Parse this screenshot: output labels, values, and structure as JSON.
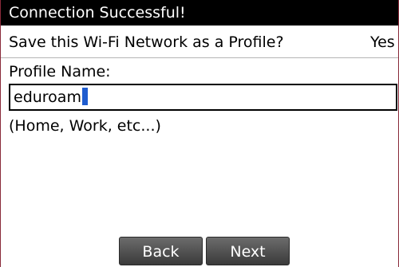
{
  "title_bar": {
    "text": "Connection Successful!"
  },
  "save_profile": {
    "question": "Save this Wi-Fi Network as a Profile?",
    "value": "Yes"
  },
  "profile_name": {
    "label": "Profile Name:",
    "value": "eduroam",
    "hint": "(Home, Work, etc...)"
  },
  "buttons": {
    "back": "Back",
    "next": "Next"
  },
  "colors": {
    "title_bg": "#000000",
    "caret": "#1f5ccf",
    "button_bg": "#4a4a4a"
  }
}
